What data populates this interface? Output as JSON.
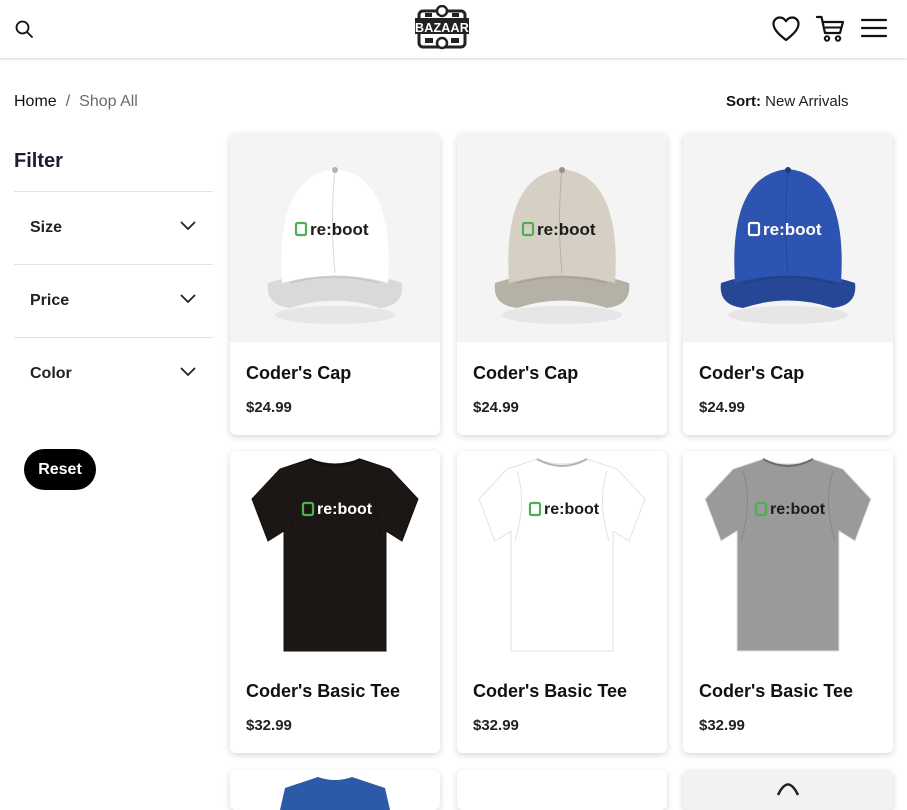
{
  "header": {
    "logo_text": "BAZAAR"
  },
  "breadcrumb": {
    "home": "Home",
    "separator": "/",
    "current": "Shop All"
  },
  "sort": {
    "label": "Sort:",
    "value": "New Arrivals"
  },
  "filter": {
    "title": "Filter",
    "items": [
      {
        "label": "Size"
      },
      {
        "label": "Price"
      },
      {
        "label": "Color"
      }
    ],
    "reset_label": "Reset"
  },
  "products": [
    {
      "name": "Coder's Cap",
      "price": "$24.99",
      "kind": "cap",
      "color": "#ffffff",
      "brand": "re:boot"
    },
    {
      "name": "Coder's Cap",
      "price": "$24.99",
      "kind": "cap",
      "color": "#d6d0c4",
      "brand": "re:boot"
    },
    {
      "name": "Coder's Cap",
      "price": "$24.99",
      "kind": "cap",
      "color": "#2c54b0",
      "brand": "re:boot"
    },
    {
      "name": "Coder's Basic Tee",
      "price": "$32.99",
      "kind": "tee",
      "color": "#1c1715",
      "brand": "re:boot"
    },
    {
      "name": "Coder's Basic Tee",
      "price": "$32.99",
      "kind": "tee",
      "color": "#ffffff",
      "brand": "re:boot"
    },
    {
      "name": "Coder's Basic Tee",
      "price": "$32.99",
      "kind": "tee",
      "color": "#9a9a9c",
      "brand": "re:boot"
    }
  ],
  "colors": {
    "brand_green": "#4caf50",
    "button_bg": "#000000",
    "muted_text": "#6b6b6b"
  }
}
